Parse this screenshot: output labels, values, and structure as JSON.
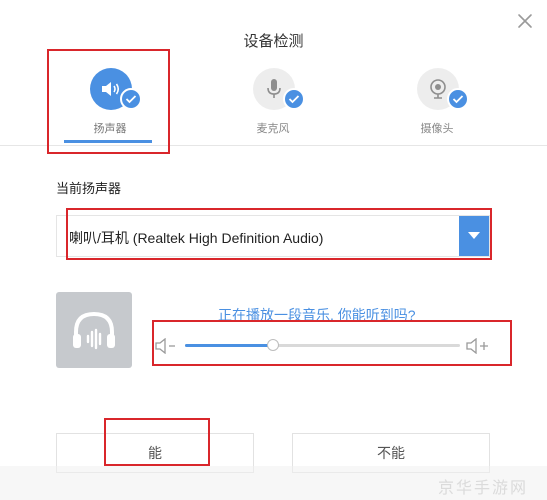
{
  "window": {
    "title": "设备检测"
  },
  "tabs": [
    {
      "label": "扬声器",
      "icon": "speaker-icon",
      "active": true
    },
    {
      "label": "麦克风",
      "icon": "microphone-icon",
      "active": false
    },
    {
      "label": "摄像头",
      "icon": "camera-icon",
      "active": false
    }
  ],
  "speaker": {
    "section_label": "当前扬声器",
    "selected_device": "喇叭/耳机 (Realtek High Definition Audio)",
    "prompt": "正在播放一段音乐, 你能听到吗?",
    "volume": 0.32
  },
  "buttons": {
    "yes": "能",
    "no": "不能"
  },
  "watermark": "京华手游网",
  "colors": {
    "accent": "#4a90e2",
    "highlight": "#d9262b",
    "icon_gray": "#e8e8e8"
  }
}
